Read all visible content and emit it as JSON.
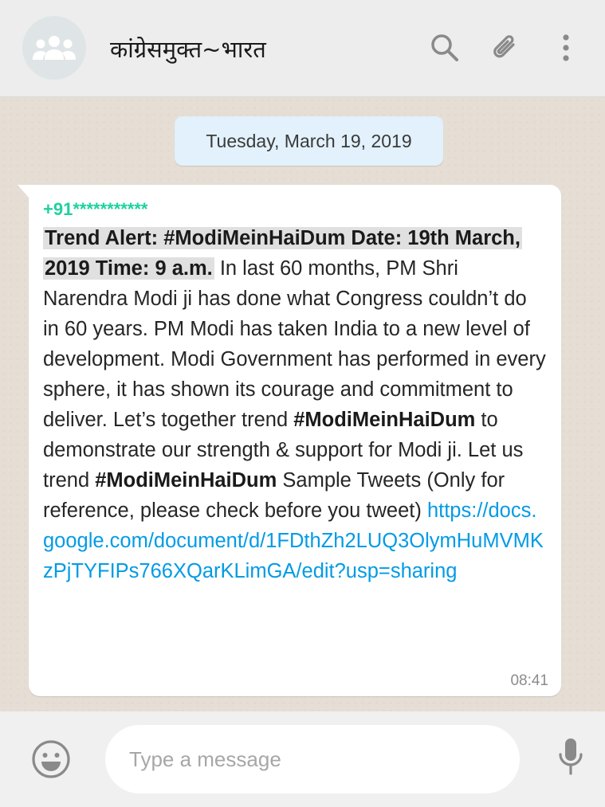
{
  "header": {
    "title": "कांग्रेसमुक्त~भारत",
    "avatar_icon": "group-avatar-icon",
    "search_icon": "search-icon",
    "attach_icon": "paperclip-icon",
    "menu_icon": "more-vertical-icon"
  },
  "chat": {
    "date_label": "Tuesday, March 19, 2019",
    "message": {
      "sender": "+91***********",
      "highlight": "Trend Alert: #ModiMeinHaiDum Date: 19th March, 2019 Time: 9 a.m.",
      "text_1": " In last 60 months, PM Shri Narendra Modi ji has done what Congress couldn’t do in 60 years. PM Modi has taken India to a new level of development. Modi Government has performed in every sphere, it has shown its courage and commitment to deliver.  Let’s together trend ",
      "hashtag_1": "#ModiMeinHaiDum",
      "text_2": " to demonstrate our strength & support for Modi ji.  Let us trend ",
      "hashtag_2": "#ModiMeinHaiDum",
      "text_3": "  Sample Tweets (Only for reference, please check before you tweet) ",
      "link": "https://docs.google.com/document/d/1FDthZh2LUQ3OlymHuMVMKzPjTYFIPs766XQarKLimGA/edit?usp=sharing",
      "time": "08:41"
    }
  },
  "composer": {
    "placeholder": "Type a message",
    "emoji_icon": "emoji-icon",
    "mic_icon": "microphone-icon"
  },
  "colors": {
    "sender": "#1fd1a0",
    "link": "#039be5",
    "date_chip": "#e2f1fb",
    "chat_bg": "#e6ded5"
  }
}
